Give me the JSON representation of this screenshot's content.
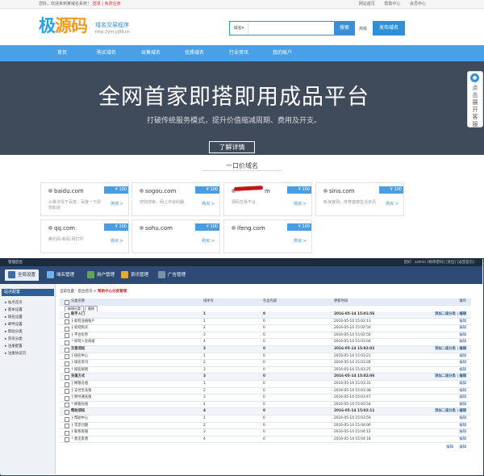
{
  "site": {
    "topbar": {
      "welcome": "您好，欢迎来到某域名系统！",
      "login": "登录",
      "register": "免费注册",
      "links": [
        "网站首页",
        "帮助中心",
        "会员中心"
      ]
    },
    "logo": {
      "part1": "极",
      "part2": "源码"
    },
    "site_name": "域名交易程序",
    "site_url": "http://ym.yj99.cn",
    "search": {
      "select_label": "域名",
      "value": "",
      "button": "搜索",
      "advanced": "高级"
    },
    "post_button": "发布域名",
    "nav": [
      "首页",
      "购买域名",
      "出售域名",
      "优质域名",
      "行业资讯",
      "我的账户"
    ],
    "hero": {
      "title": "全网首家即搭即用成品平台",
      "subtitle": "打破传统服务模式，提升价值缩减周期、费用及开支。",
      "button": "了解详情"
    },
    "service": {
      "icon": "chat-icon",
      "text": "点击展开客服"
    },
    "section_title": "一口价域名",
    "domains": [
      {
        "name": "baidu.com",
        "price": "¥ 100",
        "desc": "众量寻情于百度，百度一下即刻知道",
        "buy": "购买 >"
      },
      {
        "name": "sogou.com",
        "price": "¥ 100",
        "desc": "搜狗搜索，网上冲浪利器",
        "buy": "购买 >"
      },
      {
        "name": "m",
        "price": "¥ 100",
        "desc": "源码交易平台",
        "buy": "购买 >",
        "redacted": true
      },
      {
        "name": "sina.com",
        "price": "¥ 100",
        "desc": "新浪官网，体育健康生活资讯",
        "buy": "购买 >"
      },
      {
        "name": "qq.com",
        "price": "¥ 100",
        "desc": "腾讯网-新闻-网打尽",
        "buy": "购买 >"
      },
      {
        "name": "sohu.com",
        "price": "¥ 100",
        "desc": "",
        "buy": "购买 >"
      },
      {
        "name": "ifeng.com",
        "price": "¥ 100",
        "desc": "",
        "buy": "购买 >"
      }
    ]
  },
  "admin": {
    "title": "管理后台",
    "top_right": "您好：admin  [修改密码] [退出] [返回首页]",
    "tabs": [
      "全局设置",
      "域名管理",
      "用户管理",
      "资讯管理",
      "广告管理"
    ],
    "sidebar": {
      "head": "站点配置",
      "items": [
        "站点首页",
        "基本设置",
        "域名设置",
        "邮件设置",
        "帮助分类",
        "资讯分类",
        "注册配置",
        "注册协议页"
      ]
    },
    "breadcrumb": {
      "prefix": "当前位置：后台首页 >",
      "current": "帮助中心分类管理"
    },
    "toolbar": [
      "新增分类",
      "删除"
    ],
    "columns": [
      "分类名称",
      "排序号",
      "包含内容",
      "更新时间",
      "操作"
    ],
    "rows": [
      {
        "group": true,
        "name": "新手入门",
        "order": "1",
        "count": "0",
        "time": "2016-05-14 15:01:56",
        "op": "添加二级分类 | 编辑"
      },
      {
        "group": false,
        "name": "├ 如何注册账户",
        "order": "1",
        "count": "0",
        "time": "2016-05-14 15:02:13",
        "op": "编辑"
      },
      {
        "group": false,
        "name": "├ 如何购买",
        "order": "2",
        "count": "0",
        "time": "2016-05-14 15:02:50",
        "op": "编辑"
      },
      {
        "group": false,
        "name": "├ 平台优势",
        "order": "3",
        "count": "0",
        "time": "2016-05-14 15:02:56",
        "op": "编辑"
      },
      {
        "group": false,
        "name": "└ 如何入驻商家",
        "order": "4",
        "count": "0",
        "time": "2016-05-14 15:03:04",
        "op": "编辑"
      },
      {
        "group": true,
        "name": "交易须知",
        "order": "2",
        "count": "0",
        "time": "2016-05-14 15:02:02",
        "op": "添加二级分类 | 编辑"
      },
      {
        "group": false,
        "name": "├ 域名中心",
        "order": "1",
        "count": "0",
        "time": "2016-05-14 15:03:21",
        "op": "编辑"
      },
      {
        "group": false,
        "name": "├ 域名资讯",
        "order": "2",
        "count": "0",
        "time": "2016-05-14 15:03:28",
        "op": "编辑"
      },
      {
        "group": false,
        "name": "└ 域名规则",
        "order": "3",
        "count": "0",
        "time": "2016-05-14 15:03:25",
        "op": "编辑"
      },
      {
        "group": true,
        "name": "充值方式",
        "order": "3",
        "count": "0",
        "time": "2016-05-14 15:02:06",
        "op": "添加二级分类 | 编辑"
      },
      {
        "group": false,
        "name": "├ 网银充值",
        "order": "1",
        "count": "0",
        "time": "2016-05-14 15:03:31",
        "op": "编辑"
      },
      {
        "group": false,
        "name": "├ 支付宝充值",
        "order": "2",
        "count": "0",
        "time": "2016-05-14 15:03:38",
        "op": "编辑"
      },
      {
        "group": false,
        "name": "├ 财付通充值",
        "order": "3",
        "count": "0",
        "time": "2016-05-14 15:03:47",
        "op": "编辑"
      },
      {
        "group": false,
        "name": "└ 网银充值",
        "order": "4",
        "count": "0",
        "time": "2016-05-14 15:03:54",
        "op": "编辑"
      },
      {
        "group": true,
        "name": "帮助须知",
        "order": "4",
        "count": "0",
        "time": "2016-05-14 15:02:11",
        "op": "添加二级分类 | 编辑"
      },
      {
        "group": false,
        "name": "├ 帮助中心",
        "order": "1",
        "count": "0",
        "time": "2016-05-14 15:03:59",
        "op": "编辑"
      },
      {
        "group": false,
        "name": "├ 常见问题",
        "order": "2",
        "count": "0",
        "time": "2016-05-14 15:04:06",
        "op": "编辑"
      },
      {
        "group": false,
        "name": "├ 联系客服",
        "order": "3",
        "count": "0",
        "time": "2016-05-14 15:04:12",
        "op": "编辑"
      },
      {
        "group": false,
        "name": "└ 意见反馈",
        "order": "4",
        "count": "0",
        "time": "2016-05-14 15:04:18",
        "op": "编辑"
      }
    ],
    "footer_buttons": [
      "编辑",
      "编辑"
    ]
  }
}
